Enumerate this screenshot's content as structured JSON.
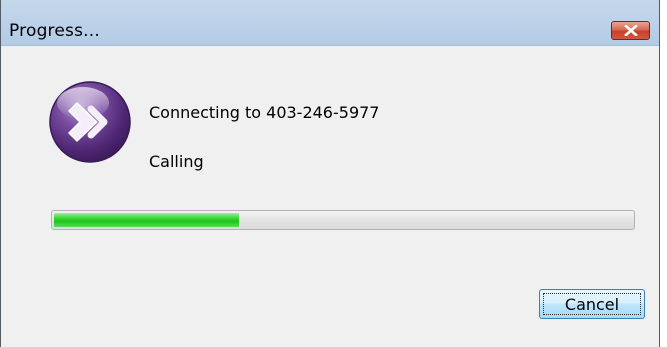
{
  "window": {
    "title": "Progress...",
    "close_icon": "close-icon"
  },
  "dialog": {
    "icon": "app-forward-icon",
    "message": "Connecting to 403-246-5977",
    "status": "Calling",
    "progress": 0.32
  },
  "buttons": {
    "cancel_label": "Cancel"
  },
  "colors": {
    "titlebar": "#bed3ea",
    "close_button": "#c7402b",
    "progress_fill": "#1fc41c",
    "icon_purple": "#5a2d82",
    "body_background": "#f0f0f0"
  }
}
